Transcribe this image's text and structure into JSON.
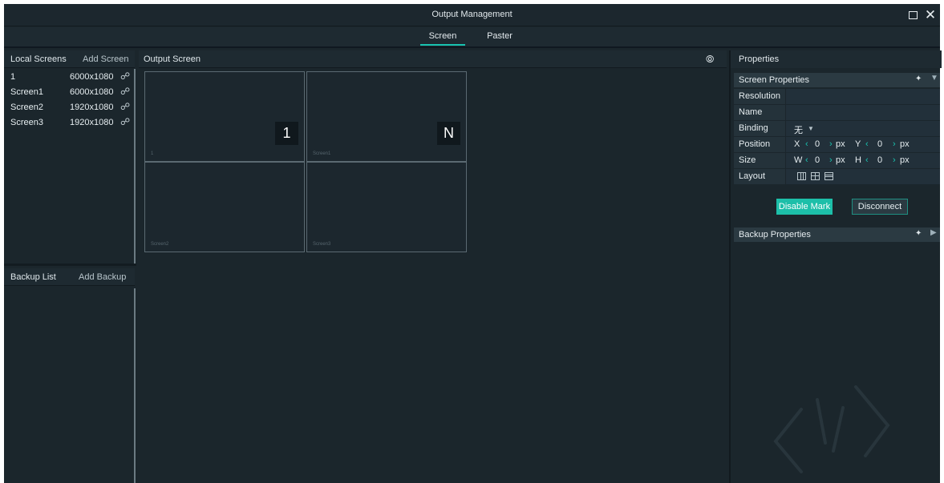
{
  "window": {
    "title": "Output Management"
  },
  "tabs": [
    {
      "label": "Screen",
      "active": true
    },
    {
      "label": "Paster",
      "active": false
    }
  ],
  "local_screens": {
    "header": "Local Screens",
    "add_label": "Add Screen",
    "items": [
      {
        "name": "1",
        "resolution": "6000x1080"
      },
      {
        "name": "Screen1",
        "resolution": "6000x1080"
      },
      {
        "name": "Screen2",
        "resolution": "1920x1080"
      },
      {
        "name": "Screen3",
        "resolution": "1920x1080"
      }
    ]
  },
  "backup_list": {
    "header": "Backup List",
    "add_label": "Add Backup"
  },
  "output_screen": {
    "header": "Output Screen",
    "cells": [
      {
        "caption": "1",
        "badge": "1"
      },
      {
        "caption": "Screen1",
        "badge": "N"
      },
      {
        "caption": "Screen2",
        "badge": ""
      },
      {
        "caption": "Screen3",
        "badge": ""
      }
    ]
  },
  "properties": {
    "header": "Properties",
    "screen_section": "Screen Properties",
    "rows": {
      "resolution_label": "Resolution",
      "name_label": "Name",
      "binding_label": "Binding",
      "binding_value": "无",
      "position_label": "Position",
      "size_label": "Size",
      "layout_label": "Layout"
    },
    "position": {
      "x_label": "X",
      "x": "0",
      "y_label": "Y",
      "y": "0",
      "unit": "px"
    },
    "size": {
      "w_label": "W",
      "w": "0",
      "h_label": "H",
      "h": "0",
      "unit": "px"
    },
    "disable_mark_label": "Disable Mark",
    "disconnect_label": "Disconnect",
    "backup_section": "Backup Properties"
  },
  "colors": {
    "accent": "#19c3b0",
    "background": "#1b262c",
    "panel_header": "#1e2a31"
  }
}
